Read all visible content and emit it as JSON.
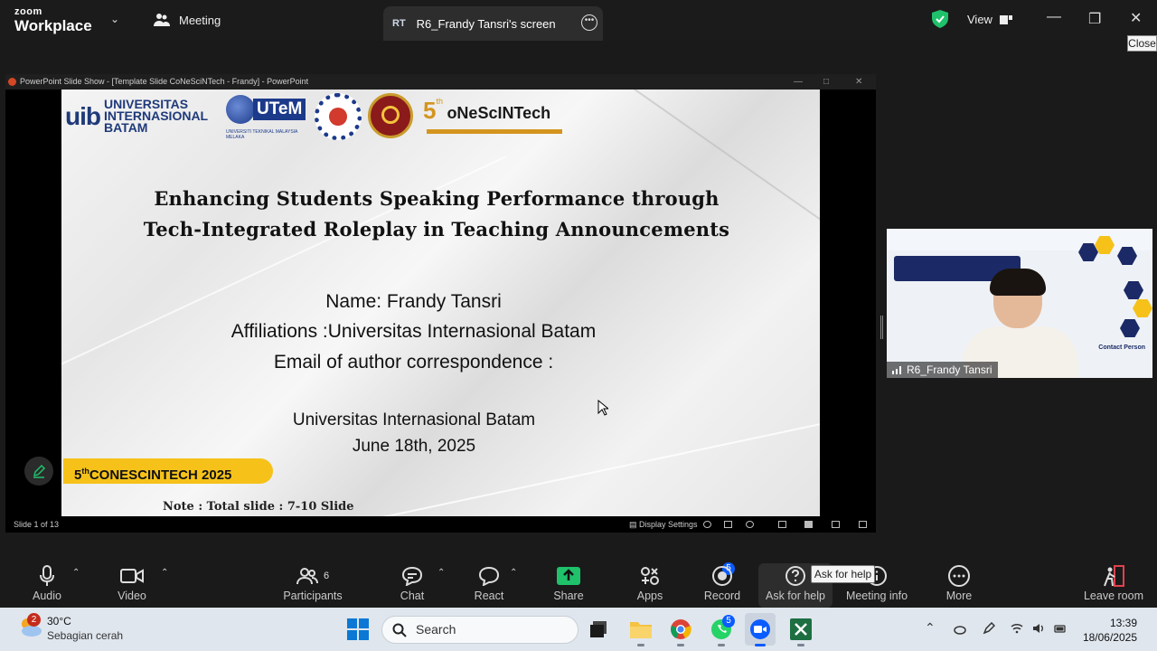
{
  "zoom": {
    "brand_top": "zoom",
    "brand_bottom": "Workplace",
    "meeting_tab": "Meeting",
    "share_tab_initials": "RT",
    "share_tab_label": "R6_Frandy Tansri's screen",
    "view_label": "View",
    "close_tooltip": "Close"
  },
  "ppt": {
    "window_title": "PowerPoint Slide Show - [Template Slide CoNeSciNTech - Frandy] - PowerPoint",
    "slide_counter": "Slide 1 of 13",
    "display_settings": "Display Settings"
  },
  "slide": {
    "logo_uib_mark": "uib",
    "logo_uib_lines": [
      "UNIVERSITAS",
      "INTERNASIONAL",
      "BATAM"
    ],
    "logo_utem": "UTeM",
    "logo_utem_sub": "UNIVERSITI TEKNIKAL MALAYSIA MELAKA",
    "logo_conf_num": "5",
    "logo_conf_sup": "th",
    "logo_conf_name": "oNeScINTech",
    "title_line1": "Enhancing Students Speaking Performance through",
    "title_line2": "Tech-Integrated Roleplay in Teaching Announcements",
    "name_line": "Name: Frandy Tansri",
    "affiliation_line": "Affiliations :Universitas Internasional Batam",
    "email_line": "Email of author correspondence :",
    "institution": "Universitas Internasional Batam",
    "date": "June 18th, 2025",
    "ribbon_prefix": "5",
    "ribbon_sup": "th",
    "ribbon_text": "CONESCINTECH 2025",
    "note": "Note : Total slide : 7-10 Slide"
  },
  "participant": {
    "name": "R6_Frandy Tansri",
    "contact_label": "Contact Person"
  },
  "toolbar": {
    "audio": "Audio",
    "video": "Video",
    "participants": "Participants",
    "participants_count": "6",
    "chat": "Chat",
    "react": "React",
    "share": "Share",
    "apps": "Apps",
    "apps_badge": "5",
    "record": "Record",
    "ask_for_help": "Ask for help",
    "ask_tooltip": "Ask for help",
    "meeting_info": "Meeting info",
    "more": "More",
    "leave_room": "Leave room"
  },
  "taskbar": {
    "weather_badge": "2",
    "temperature": "30°C",
    "weather_desc": "Sebagian cerah",
    "search_placeholder": "Search",
    "time": "13:39",
    "date": "18/06/2025"
  },
  "colors": {
    "share_green": "#1fc16b",
    "zoom_blue": "#0b5cff",
    "ribbon_yellow": "#f6c21a",
    "leave_red": "#e0424d"
  }
}
